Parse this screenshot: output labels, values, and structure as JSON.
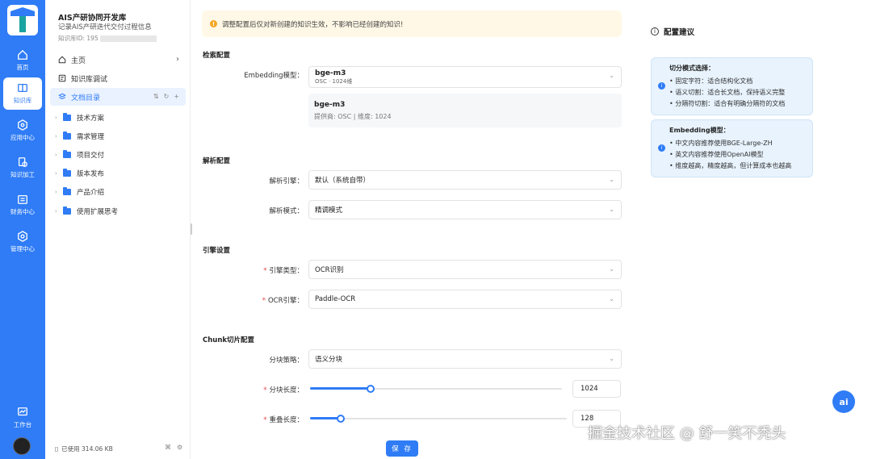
{
  "rail": {
    "items": [
      {
        "label": "首页",
        "icon": "home-icon"
      },
      {
        "label": "知识库",
        "icon": "book-icon"
      },
      {
        "label": "应用中心",
        "icon": "app-icon"
      },
      {
        "label": "知识加工",
        "icon": "process-icon"
      },
      {
        "label": "财务中心",
        "icon": "finance-icon"
      },
      {
        "label": "管理中心",
        "icon": "settings-icon"
      }
    ],
    "workbench": "工作台"
  },
  "sidebar": {
    "kb_title": "AIS产研协同开发库",
    "kb_subtitle": "记录AIS产研迭代交付过程信息",
    "kb_id_label": "知识库ID: 195",
    "nav": [
      {
        "label": "主页"
      },
      {
        "label": "知识库调试"
      },
      {
        "label": "文档目录"
      }
    ],
    "tree": [
      "技术方案",
      "需求管理",
      "项目交付",
      "版本发布",
      "产品介绍",
      "使用扩展思考"
    ],
    "usage": "已使用 314.06 KB"
  },
  "notice": "调整配置后仅对新创建的知识生效，不影响已经创建的知识!",
  "sections": {
    "retrieval": {
      "title": "检索配置",
      "embedding_label": "Embedding模型：",
      "embedding_value": "bge-m3",
      "embedding_sub": "OSC · 1024维",
      "card_name": "bge-m3",
      "card_info": "提供商: OSC | 维度: 1024"
    },
    "parse": {
      "title": "解析配置",
      "engine_label": "解析引擎：",
      "engine_value": "默认（系统自带）",
      "mode_label": "解析模式：",
      "mode_value": "精调模式"
    },
    "engine": {
      "title": "引擎设置",
      "type_label": "引擎类型：",
      "type_value": "OCR识别",
      "ocr_label": "OCR引擎：",
      "ocr_value": "Paddle-OCR"
    },
    "chunk": {
      "title": "Chunk切片配置",
      "strategy_label": "分块策略：",
      "strategy_value": "语义分块",
      "length_label": "分块长度：",
      "length_value": "1024",
      "length_fraction": 0.24,
      "overlap_label": "重叠长度：",
      "overlap_value": "128",
      "overlap_fraction": 0.12
    }
  },
  "save_label": "保 存",
  "tips": {
    "title": "配置建议",
    "cards": [
      {
        "heading": "切分模式选择：",
        "items": [
          "• 固定字符：适合结构化文档",
          "• 语义切割：适合长文档，保持语义完整",
          "• 分隔符切割：适合有明确分隔符的文档"
        ]
      },
      {
        "heading": "Embedding模型：",
        "items": [
          "• 中文内容推荐使用BGE-Large-ZH",
          "• 英文内容推荐使用OpenAI模型",
          "• 维度越高，精度越高，但计算成本也越高"
        ]
      }
    ]
  },
  "ai_button": "ai",
  "watermark": "掘金技术社区 @ 舒一笑不秃头",
  "colors": {
    "accent": "#2f7cf6",
    "warning": "#f5a623",
    "required": "#e54545"
  }
}
